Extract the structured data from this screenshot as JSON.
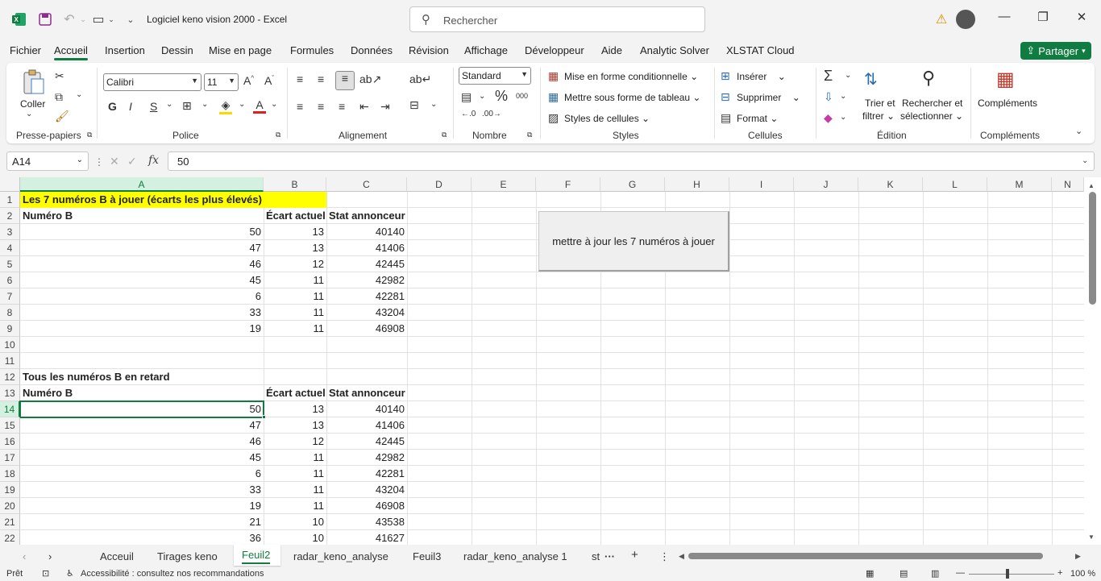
{
  "titlebar": {
    "title": "Logiciel keno vision 2000  -  Excel",
    "search_placeholder": "Rechercher",
    "app_icon": "excel-icon"
  },
  "menu_tabs": [
    "Fichier",
    "Accueil",
    "Insertion",
    "Dessin",
    "Mise en page",
    "Formules",
    "Données",
    "Révision",
    "Affichage",
    "Développeur",
    "Aide",
    "Analytic Solver",
    "XLSTAT Cloud"
  ],
  "share_label": "Partager",
  "ribbon": {
    "clipboard": {
      "paste_label": "Coller",
      "group": "Presse-papiers"
    },
    "font": {
      "name": "Calibri",
      "size": "11",
      "group": "Police",
      "bold": "G",
      "italic": "I",
      "underline": "S"
    },
    "alignment": {
      "group": "Alignement"
    },
    "number": {
      "format": "Standard",
      "group": "Nombre",
      "percent": "%",
      "thousands": "000"
    },
    "styles": {
      "conditional": "Mise en forme conditionnelle",
      "table": "Mettre sous forme de tableau",
      "cell_styles": "Styles de cellules",
      "group": "Styles"
    },
    "cells": {
      "insert": "Insérer",
      "delete": "Supprimer",
      "format": "Format",
      "group": "Cellules"
    },
    "editing": {
      "sort_line1": "Trier et",
      "sort_line2": "filtrer",
      "find_line1": "Rechercher et",
      "find_line2": "sélectionner",
      "group": "Édition"
    },
    "addins": {
      "label": "Compléments",
      "group": "Compléments"
    }
  },
  "formula_bar": {
    "name_box": "A14",
    "fx": "fx",
    "value": "50"
  },
  "columns": [
    "A",
    "B",
    "C",
    "D",
    "E",
    "F",
    "G",
    "H",
    "I",
    "J",
    "K",
    "L",
    "M",
    "N"
  ],
  "rows": [
    {
      "n": "1",
      "a": "Les 7 numéros B à jouer (écarts les plus élevés)",
      "b": "",
      "c": "",
      "style": "title-yellow"
    },
    {
      "n": "2",
      "a": "Numéro B",
      "b": "Écart actuel",
      "c": "Stat annonceur",
      "style": "header"
    },
    {
      "n": "3",
      "a": "50",
      "b": "13",
      "c": "40140"
    },
    {
      "n": "4",
      "a": "47",
      "b": "13",
      "c": "41406"
    },
    {
      "n": "5",
      "a": "46",
      "b": "12",
      "c": "42445"
    },
    {
      "n": "6",
      "a": "45",
      "b": "11",
      "c": "42982"
    },
    {
      "n": "7",
      "a": "6",
      "b": "11",
      "c": "42281"
    },
    {
      "n": "8",
      "a": "33",
      "b": "11",
      "c": "43204"
    },
    {
      "n": "9",
      "a": "19",
      "b": "11",
      "c": "46908"
    },
    {
      "n": "10",
      "a": "",
      "b": "",
      "c": ""
    },
    {
      "n": "11",
      "a": "",
      "b": "",
      "c": ""
    },
    {
      "n": "12",
      "a": "Tous les numéros B en retard",
      "b": "",
      "c": "",
      "style": "title"
    },
    {
      "n": "13",
      "a": "Numéro B",
      "b": "Écart actuel",
      "c": "Stat annonceur",
      "style": "header"
    },
    {
      "n": "14",
      "a": "50",
      "b": "13",
      "c": "40140"
    },
    {
      "n": "15",
      "a": "47",
      "b": "13",
      "c": "41406"
    },
    {
      "n": "16",
      "a": "46",
      "b": "12",
      "c": "42445"
    },
    {
      "n": "17",
      "a": "45",
      "b": "11",
      "c": "42982"
    },
    {
      "n": "18",
      "a": "6",
      "b": "11",
      "c": "42281"
    },
    {
      "n": "19",
      "a": "33",
      "b": "11",
      "c": "43204"
    },
    {
      "n": "20",
      "a": "19",
      "b": "11",
      "c": "46908"
    },
    {
      "n": "21",
      "a": "21",
      "b": "10",
      "c": "43538"
    },
    {
      "n": "22",
      "a": "36",
      "b": "10",
      "c": "41627"
    }
  ],
  "selected_cell": "A14",
  "macro_button": "mettre à jour les 7 numéros à jouer",
  "sheet_tabs": [
    "Acceuil",
    "Tirages keno",
    "Feuil2",
    "radar_keno_analyse",
    "Feuil3",
    "radar_keno_analyse 1",
    "st"
  ],
  "active_sheet": "Feuil2",
  "status": {
    "ready": "Prêt",
    "accessibility": "Accessibilité : consultez nos recommandations",
    "zoom": "100 %"
  },
  "colors": {
    "excel_green": "#107c41",
    "highlight_yellow": "#ffff00"
  }
}
